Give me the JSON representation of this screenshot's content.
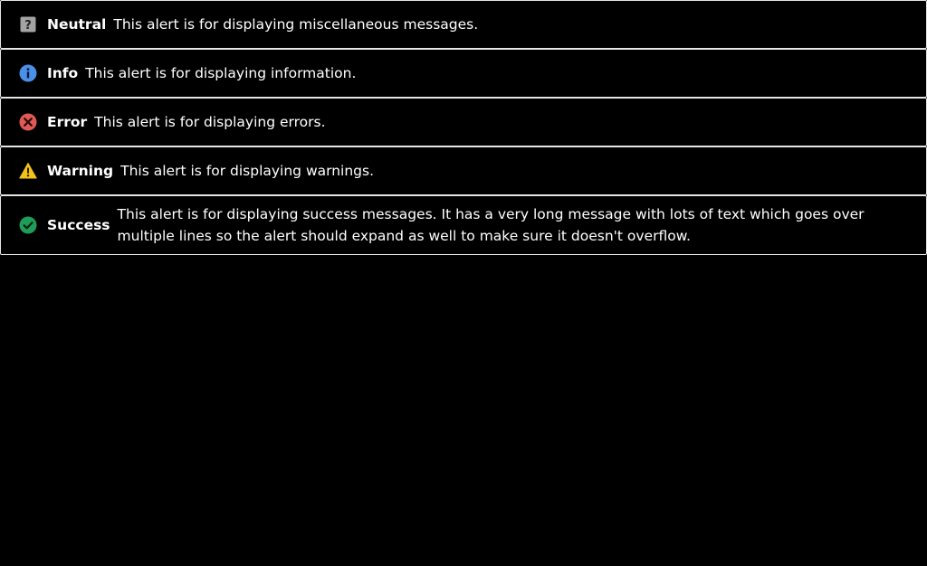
{
  "colors": {
    "background": "#000000",
    "border": "#e6e6e6",
    "text": "#ffffff",
    "neutral": "#a3a3a3",
    "info": "#4a8fe8",
    "error": "#e05a55",
    "warning": "#f2c21a",
    "success": "#1f9d58"
  },
  "alerts": [
    {
      "type": "neutral",
      "icon": "question-mark-icon",
      "title": "Neutral",
      "message": "This alert is for displaying miscellaneous messages."
    },
    {
      "type": "info",
      "icon": "info-icon",
      "title": "Info",
      "message": "This alert is for displaying information."
    },
    {
      "type": "error",
      "icon": "error-x-icon",
      "title": "Error",
      "message": "This alert is for displaying errors."
    },
    {
      "type": "warning",
      "icon": "warning-triangle-icon",
      "title": "Warning",
      "message": "This alert is for displaying warnings."
    },
    {
      "type": "success",
      "icon": "checkmark-circle-icon",
      "title": "Success",
      "message": "This alert is for displaying success messages. It has a very long message with lots of text which goes over multiple lines so the alert should expand as well to make sure it doesn't overflow."
    }
  ]
}
